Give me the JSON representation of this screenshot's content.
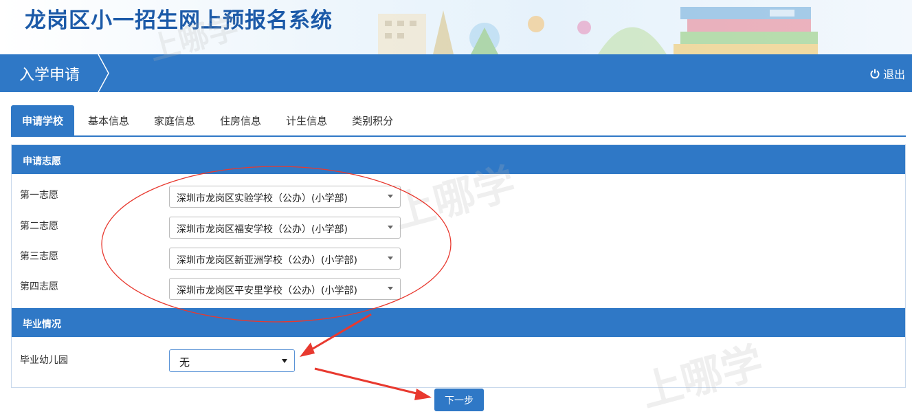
{
  "header": {
    "title": "龙岗区小一招生网上预报名系统"
  },
  "navbar": {
    "title": "入学申请",
    "logout_label": "退出"
  },
  "tabs": [
    {
      "label": "申请学校",
      "active": true
    },
    {
      "label": "基本信息",
      "active": false
    },
    {
      "label": "家庭信息",
      "active": false
    },
    {
      "label": "住房信息",
      "active": false
    },
    {
      "label": "计生信息",
      "active": false
    },
    {
      "label": "类别积分",
      "active": false
    }
  ],
  "preferences": {
    "section_title": "申请志愿",
    "items": [
      {
        "label": "第一志愿",
        "value": "深圳市龙岗区实验学校（公办）(小学部)"
      },
      {
        "label": "第二志愿",
        "value": "深圳市龙岗区福安学校（公办）(小学部)"
      },
      {
        "label": "第三志愿",
        "value": "深圳市龙岗区新亚洲学校（公办）(小学部)"
      },
      {
        "label": "第四志愿",
        "value": "深圳市龙岗区平安里学校（公办）(小学部)"
      }
    ]
  },
  "graduation": {
    "section_title": "毕业情况",
    "kindergarten_label": "毕业幼儿园",
    "kindergarten_value": "无"
  },
  "next_button_label": "下一步",
  "watermarks": [
    "上哪学",
    "上哪学",
    "上哪学"
  ],
  "colors": {
    "primary": "#2f78c6",
    "title": "#1c5aa8",
    "annotation": "#e8392f"
  }
}
